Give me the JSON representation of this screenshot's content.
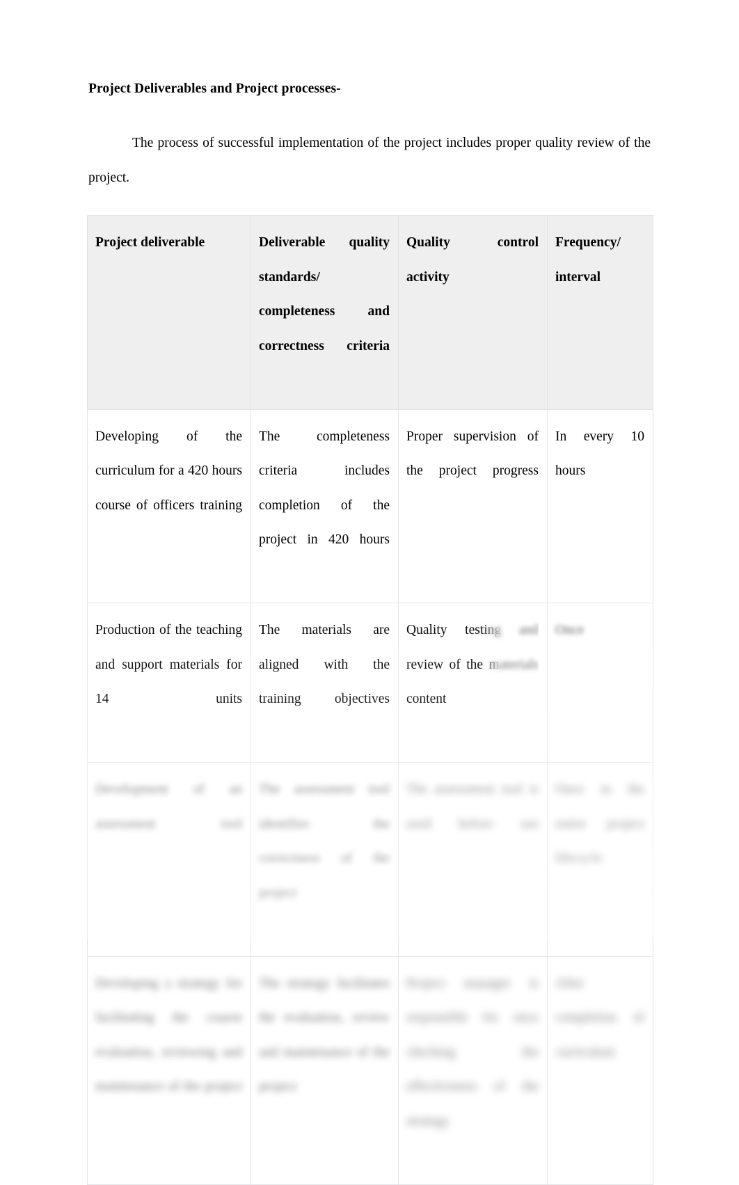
{
  "document": {
    "heading": "Project Deliverables and Project processes-",
    "paragraph": "The process of successful implementation of the project includes proper quality review of the project."
  },
  "table": {
    "headers": [
      "Project deliverable",
      "Deliverable quality standards/ completeness and correctness criteria",
      "Quality control activity",
      "Frequency/ interval"
    ],
    "rows": [
      {
        "deliverable": "Developing of the curriculum for a 420 hours course of officers training",
        "standards": "The completeness criteria includes completion of the project in 420 hours",
        "activity": "Proper supervision of the project progress",
        "frequency": "In every 10 hours",
        "blur": "none"
      },
      {
        "deliverable": "Production of the teaching and support materials for 14 units",
        "standards": "The materials are aligned with the training objectives",
        "activity": "Quality testing and review of the materials content",
        "frequency": "Once",
        "blur": "partial"
      },
      {
        "deliverable": "Development of an assessment tool",
        "standards": "The assessment tool identifies the correctness of the project",
        "activity": "The assessment tool is used before use",
        "frequency": "Once in the entire project lifecycle",
        "blur": "full"
      },
      {
        "deliverable": "Developing a strategy for facilitating the course evaluation, reviewing and maintenance of the project",
        "standards": "The strategy facilitates the evaluation, review and maintenance of the project",
        "activity": "Project manager is responsible for once checking the effectiveness of the strategy",
        "frequency": "After completion of curriculum",
        "blur": "full"
      }
    ]
  },
  "colors": {
    "header_background": "#efefef",
    "border": "#e3e6e8",
    "text": "#000000",
    "page_background": "#ffffff"
  }
}
